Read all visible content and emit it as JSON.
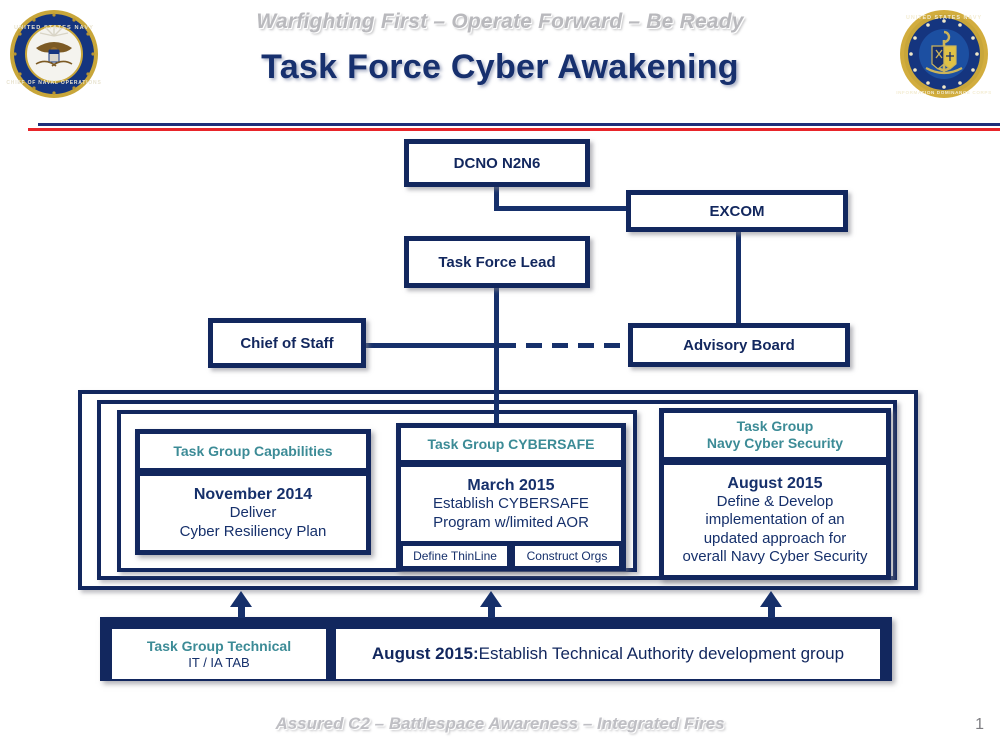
{
  "header": {
    "tagline": "Warfighting First – Operate Forward – Be Ready",
    "title": "Task Force Cyber Awakening",
    "seal_left": "us-navy-chief-of-naval-operations-seal",
    "seal_right": "us-navy-information-dominance-corps-seal",
    "rule_blue_color": "#1f2f7a",
    "rule_red_color": "#e8252a"
  },
  "chart_data": {
    "type": "diagram",
    "title": "Task Force Cyber Awakening organization chart",
    "accent_navy": "#12275e",
    "accent_teal": "#3c8b96",
    "nodes": [
      {
        "id": "dcno",
        "label": "DCNO N2N6"
      },
      {
        "id": "excom",
        "label": "EXCOM"
      },
      {
        "id": "tf_lead",
        "label": "Task Force Lead"
      },
      {
        "id": "chief_of_staff",
        "label": "Chief of Staff"
      },
      {
        "id": "advisory_board",
        "label": "Advisory Board"
      }
    ],
    "edges": [
      {
        "from": "dcno",
        "to": "excom",
        "style": "solid"
      },
      {
        "from": "dcno",
        "to": "tf_lead",
        "style": "solid"
      },
      {
        "from": "excom",
        "to": "advisory_board",
        "style": "solid"
      },
      {
        "from": "tf_lead",
        "to": "task_groups",
        "style": "solid"
      },
      {
        "from": "chief_of_staff",
        "to": "advisory_board",
        "style": "dashed"
      }
    ]
  },
  "org": {
    "dcno": "DCNO N2N6",
    "excom": "EXCOM",
    "task_force_lead": "Task Force Lead",
    "chief_of_staff": "Chief of Staff",
    "advisory_board": "Advisory Board"
  },
  "task_groups": [
    {
      "id": "capabilities",
      "header": "Task Group Capabilities",
      "date": "November 2014",
      "lines": [
        "Deliver",
        "Cyber Resiliency Plan"
      ],
      "chips": []
    },
    {
      "id": "cybersafe",
      "header": "Task Group CYBERSAFE",
      "date": "March 2015",
      "lines": [
        "Establish CYBERSAFE",
        "Program w/limited AOR"
      ],
      "chips": [
        "Define ThinLine",
        "Construct Orgs"
      ]
    },
    {
      "id": "navy_cyber_security",
      "header": "Task Group\nNavy Cyber Security",
      "header_line1": "Task Group",
      "header_line2": "Navy Cyber Security",
      "date": "August 2015",
      "lines": [
        "Define & Develop",
        "implementation of an",
        "updated approach for",
        "overall Navy Cyber Security"
      ],
      "chips": []
    }
  ],
  "technical": {
    "header_line1": "Task Group Technical",
    "header_line2": "IT / IA TAB",
    "statement_bold": "August 2015:",
    "statement_rest": " Establish Technical Authority development group"
  },
  "footer": {
    "tagline": "Assured C2  –  Battlespace Awareness  –  Integrated Fires",
    "page_number": "1"
  }
}
